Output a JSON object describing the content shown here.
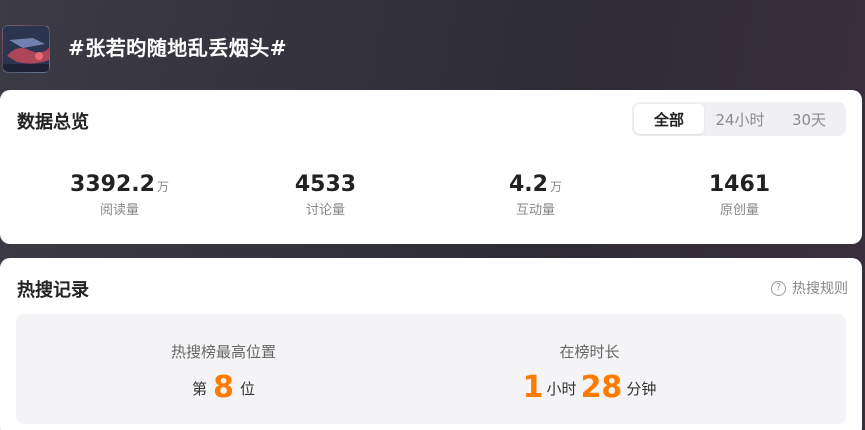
{
  "header": {
    "topic_title": "#张若昀随地乱丢烟头#"
  },
  "overview": {
    "title": "数据总览",
    "tabs": [
      {
        "label": "全部",
        "active": true
      },
      {
        "label": "24小时",
        "active": false
      },
      {
        "label": "30天",
        "active": false
      }
    ],
    "stats": [
      {
        "value": "3392.2",
        "unit": "万",
        "label": "阅读量"
      },
      {
        "value": "4533",
        "unit": "",
        "label": "讨论量"
      },
      {
        "value": "4.2",
        "unit": "万",
        "label": "互动量"
      },
      {
        "value": "1461",
        "unit": "",
        "label": "原创量"
      }
    ]
  },
  "hot_search": {
    "title": "热搜记录",
    "rules_label": "热搜规则",
    "rules_icon": "?",
    "highest_rank": {
      "label": "热搜榜最高位置",
      "prefix": "第",
      "value": "8",
      "suffix": "位"
    },
    "duration": {
      "label": "在榜时长",
      "hours": "1",
      "hours_unit": "小时",
      "minutes": "28",
      "minutes_unit": "分钟"
    }
  },
  "colors": {
    "accent_orange": "#ff7b00",
    "background_dark": "#34333d"
  }
}
